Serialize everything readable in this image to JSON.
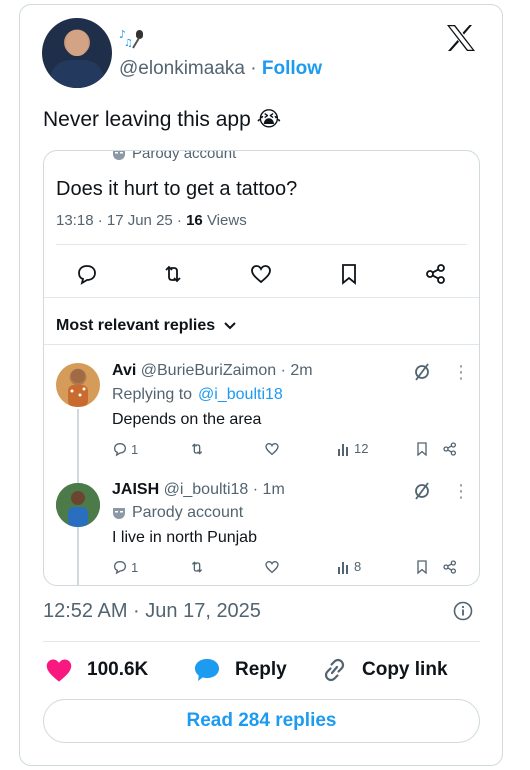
{
  "author": {
    "handle": "@elonkimaaka",
    "separator": "·",
    "follow_label": "Follow",
    "display_icon": "microphone-notes-icon"
  },
  "tweet": {
    "text": "Never leaving this app 😭"
  },
  "quoted": {
    "parody_label": "Parody account",
    "question": "Does it hurt to get a tattoo?",
    "time": "13:18 · 17 Jun 25 · ",
    "views_count": "16",
    "views_label": " Views",
    "sort_label": "Most relevant replies",
    "replies": [
      {
        "name": "Avi",
        "handle": "@BurieBuriZaimon · 2m",
        "replying_prefix": "Replying to",
        "replying_to": "@i_boulti18",
        "text": "Depends on the area",
        "reply_count": "1",
        "views": "12"
      },
      {
        "name": "JAISH",
        "handle": "@i_boulti18 · 1m",
        "parody_label": "Parody account",
        "text": "I live in north Punjab",
        "reply_count": "1",
        "views": "8"
      }
    ]
  },
  "footer": {
    "timestamp": "12:52 AM · Jun 17, 2025",
    "likes": "100.6K",
    "reply_label": "Reply",
    "copy_label": "Copy link",
    "read_replies_label": "Read 284 replies"
  },
  "colors": {
    "accent": "#1d9bf0",
    "like": "#f91880",
    "muted": "#536471",
    "border": "#cfd9de"
  }
}
